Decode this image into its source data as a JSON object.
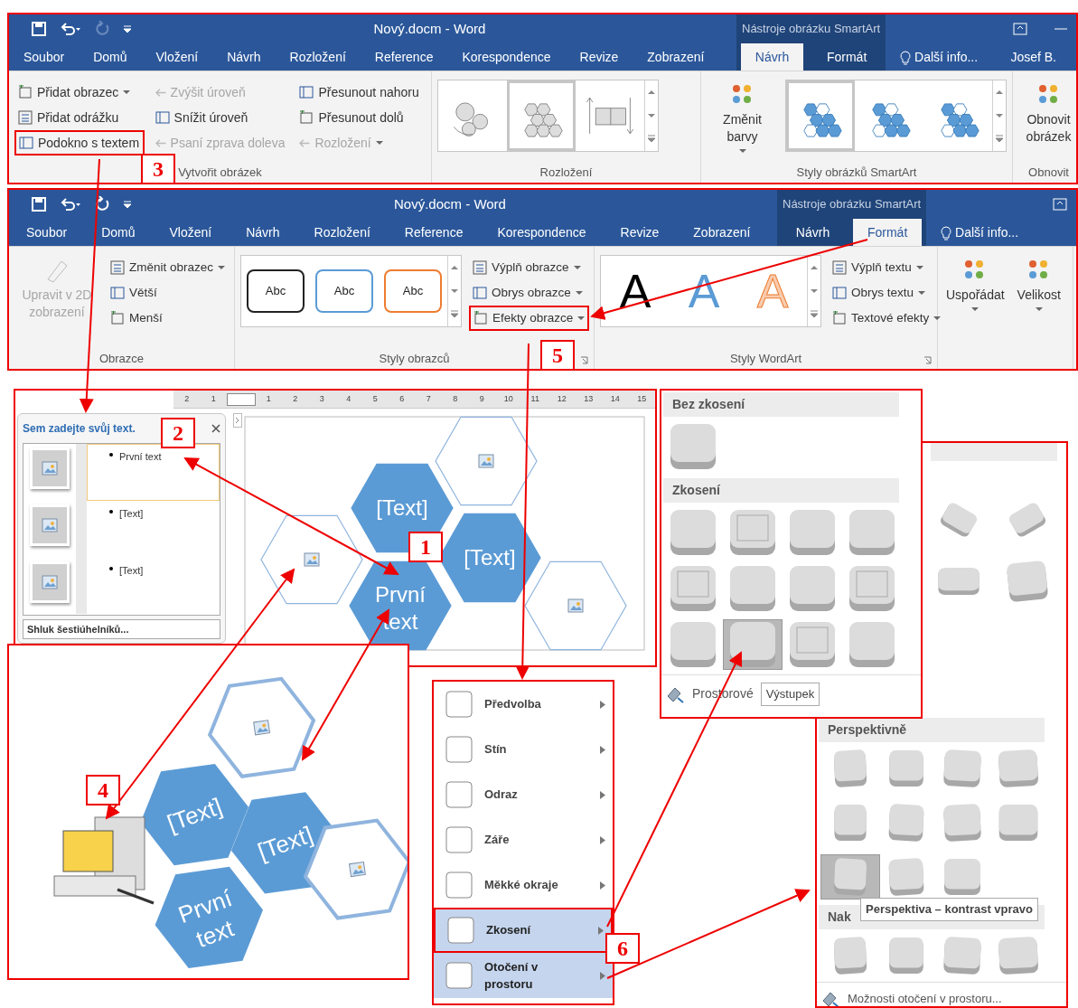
{
  "ribbons": [
    {
      "title": "Nový.docm - Word",
      "context_label": "Nástroje obrázku SmartArt",
      "redo_disabled": true,
      "minimize": true,
      "tabs": [
        {
          "label": "Soubor",
          "selected": false,
          "kind": "tab"
        },
        {
          "label": "Domů",
          "selected": false,
          "kind": "tab"
        },
        {
          "label": "Vložení",
          "selected": false,
          "kind": "tab"
        },
        {
          "label": "Návrh",
          "selected": false,
          "kind": "tab"
        },
        {
          "label": "Rozložení",
          "selected": false,
          "kind": "tab"
        },
        {
          "label": "Reference",
          "selected": false,
          "kind": "tab"
        },
        {
          "label": "Korespondence",
          "selected": false,
          "kind": "tab"
        },
        {
          "label": "Revize",
          "selected": false,
          "kind": "tab"
        },
        {
          "label": "Zobrazení",
          "selected": false,
          "kind": "tab"
        },
        {
          "label": "Návrh",
          "selected": true,
          "kind": "context"
        },
        {
          "label": "Formát",
          "selected": false,
          "kind": "context"
        },
        {
          "label": "Další info...",
          "selected": false,
          "kind": "tellme"
        },
        {
          "label": "Josef B.",
          "selected": false,
          "kind": "user"
        }
      ],
      "groups": [
        {
          "label": "Vytvořit obrázek",
          "items": [
            {
              "kind": "column",
              "commands": [
                {
                  "label": "Přidat obrazec",
                  "disabled": false,
                  "dropdown": true,
                  "highlight": false
                },
                {
                  "label": "Přidat odrážku",
                  "disabled": false,
                  "dropdown": false,
                  "highlight": false
                },
                {
                  "label": "Podokno s textem",
                  "disabled": false,
                  "dropdown": false,
                  "highlight": true
                }
              ]
            },
            {
              "kind": "column",
              "commands": [
                {
                  "label": "Zvýšit úroveň",
                  "disabled": true,
                  "dropdown": false,
                  "highlight": false
                },
                {
                  "label": "Snížit úroveň",
                  "disabled": false,
                  "dropdown": false,
                  "highlight": false
                },
                {
                  "label": "Psaní zprava doleva",
                  "disabled": true,
                  "dropdown": false,
                  "highlight": false
                }
              ]
            },
            {
              "kind": "column",
              "commands": [
                {
                  "label": "Přesunout nahoru",
                  "disabled": false,
                  "dropdown": false,
                  "highlight": false
                },
                {
                  "label": "Přesunout dolů",
                  "disabled": false,
                  "dropdown": false,
                  "highlight": false
                },
                {
                  "label": "Rozložení",
                  "disabled": true,
                  "dropdown": true,
                  "highlight": false
                }
              ]
            }
          ]
        },
        {
          "label": "Rozložení",
          "items": [
            {
              "kind": "gallery",
              "tiles": [
                {
                  "kind": "gears",
                  "selected": false
                },
                {
                  "kind": "cluster",
                  "selected": true
                },
                {
                  "kind": "boxes",
                  "selected": false
                }
              ]
            }
          ]
        },
        {
          "label": "Styly obrázků SmartArt",
          "items": [
            {
              "kind": "large",
              "label": "Změnit barvy",
              "disabled": false,
              "dropdown": true,
              "highlight": false
            },
            {
              "kind": "gallery",
              "tiles": [
                {
                  "kind": "hexstyle",
                  "selected": true
                },
                {
                  "kind": "hexstyle",
                  "selected": false
                },
                {
                  "kind": "hexstyle",
                  "selected": false
                }
              ]
            }
          ]
        },
        {
          "label": "Obnovit",
          "items": [
            {
              "kind": "large",
              "label": "Obnovit obrázek",
              "disabled": false,
              "dropdown": false,
              "highlight": false
            }
          ]
        }
      ]
    },
    {
      "title": "Nový.docm - Word",
      "context_label": "Nástroje obrázku SmartArt",
      "redo_disabled": false,
      "tabs": [
        {
          "label": "Soubor",
          "selected": false,
          "kind": "tab"
        },
        {
          "label": "Domů",
          "selected": false,
          "kind": "tab"
        },
        {
          "label": "Vložení",
          "selected": false,
          "kind": "tab"
        },
        {
          "label": "Návrh",
          "selected": false,
          "kind": "tab"
        },
        {
          "label": "Rozložení",
          "selected": false,
          "kind": "tab"
        },
        {
          "label": "Reference",
          "selected": false,
          "kind": "tab"
        },
        {
          "label": "Korespondence",
          "selected": false,
          "kind": "tab"
        },
        {
          "label": "Revize",
          "selected": false,
          "kind": "tab"
        },
        {
          "label": "Zobrazení",
          "selected": false,
          "kind": "tab"
        },
        {
          "label": "Návrh",
          "selected": false,
          "kind": "context"
        },
        {
          "label": "Formát",
          "selected": true,
          "kind": "context"
        },
        {
          "label": "Další info...",
          "selected": false,
          "kind": "tellme"
        }
      ],
      "groups": [
        {
          "label": "Obrazce",
          "items": [
            {
              "kind": "large",
              "label": "Upravit v 2D zobrazení",
              "disabled": true,
              "dropdown": false,
              "highlight": false
            },
            {
              "kind": "column",
              "commands": [
                {
                  "label": "Změnit obrazec",
                  "disabled": false,
                  "dropdown": true,
                  "highlight": false
                },
                {
                  "label": "Větší",
                  "disabled": false,
                  "dropdown": false,
                  "highlight": false
                },
                {
                  "label": "Menší",
                  "disabled": false,
                  "dropdown": false,
                  "highlight": false
                }
              ]
            }
          ]
        },
        {
          "label": "Styly obrazců",
          "launcher": true,
          "items": [
            {
              "kind": "gallery",
              "tiles": [
                {
                  "kind": "abc",
                  "text": "Abc",
                  "color": "#222222",
                  "selected": false
                },
                {
                  "kind": "abc",
                  "text": "Abc",
                  "color": "#5b9bd5",
                  "selected": false
                },
                {
                  "kind": "abc",
                  "text": "Abc",
                  "color": "#ed7d31",
                  "selected": false
                }
              ]
            },
            {
              "kind": "column",
              "commands": [
                {
                  "label": "Výplň obrazce",
                  "disabled": false,
                  "dropdown": true,
                  "highlight": false
                },
                {
                  "label": "Obrys obrazce",
                  "disabled": false,
                  "dropdown": true,
                  "highlight": false
                },
                {
                  "label": "Efekty obrazce",
                  "disabled": false,
                  "dropdown": true,
                  "highlight": true
                }
              ]
            }
          ]
        },
        {
          "label": "Styly WordArt",
          "launcher": true,
          "items": [
            {
              "kind": "gallery",
              "tiles": [
                {
                  "kind": "wordart",
                  "text": "A",
                  "color": "#000000",
                  "selected": false
                },
                {
                  "kind": "wordart",
                  "text": "A",
                  "color": "#5b9bd5",
                  "selected": false
                },
                {
                  "kind": "wordart",
                  "text": "A",
                  "color": "#f8cbad",
                  "selected": false
                }
              ]
            },
            {
              "kind": "column",
              "commands": [
                {
                  "label": "Výplň textu",
                  "disabled": false,
                  "dropdown": true,
                  "highlight": false
                },
                {
                  "label": "Obrys textu",
                  "disabled": false,
                  "dropdown": true,
                  "highlight": false
                },
                {
                  "label": "Textové efekty",
                  "disabled": false,
                  "dropdown": true,
                  "highlight": false
                }
              ]
            }
          ]
        },
        {
          "items": [
            {
              "kind": "large",
              "label": "Uspořádat",
              "disabled": false,
              "dropdown": true,
              "highlight": false
            },
            {
              "kind": "large",
              "label": "Velikost",
              "disabled": false,
              "dropdown": true,
              "highlight": false
            }
          ]
        }
      ]
    }
  ],
  "ruler": [
    "2",
    "1",
    "1",
    "2",
    "3",
    "4",
    "5",
    "6",
    "7",
    "8",
    "9",
    "10",
    "11",
    "12",
    "13",
    "14",
    "15"
  ],
  "text_pane": {
    "title": "Sem zadejte svůj text.",
    "items": [
      {
        "text": "První text",
        "selected": true
      },
      {
        "text": "[Text]",
        "selected": false
      },
      {
        "text": "[Text]",
        "selected": false
      }
    ],
    "footer": "Shluk šestiúhelníků..."
  },
  "canvas": {
    "shapes": [
      {
        "filled": false
      },
      {
        "text": "[Text]",
        "filled": true
      },
      {
        "text": "[Text]",
        "filled": true
      },
      {
        "text": "První text",
        "filled": true
      },
      {
        "filled": false
      },
      {
        "filled": false
      }
    ]
  },
  "illustration": {
    "shapes": [
      {
        "filled": false
      },
      {
        "text": "[Text]",
        "filled": true
      },
      {
        "text": "[Text]",
        "filled": true
      },
      {
        "text": "První text",
        "filled": true
      },
      {
        "filled": false
      }
    ]
  },
  "bevel_gallery": {
    "sections": [
      {
        "title": "Bez zkosení",
        "tiles": [
          {
            "selected": false
          }
        ]
      },
      {
        "title": "Zkosení",
        "tiles": [
          {
            "selected": false
          },
          {
            "selected": false
          },
          {
            "selected": false
          },
          {
            "selected": false
          },
          {
            "selected": false
          },
          {
            "selected": false
          },
          {
            "selected": false
          },
          {
            "selected": false
          },
          {
            "selected": false
          },
          {
            "selected": true
          },
          {
            "selected": false
          },
          {
            "selected": false
          }
        ]
      }
    ],
    "footer": "Prostorové",
    "tooltip": "Výstupek"
  },
  "rotation_gallery": {
    "top_tiles": [
      {
        "selected": false
      },
      {
        "selected": false
      },
      {
        "selected": false
      },
      {
        "selected": false
      }
    ],
    "sections": [
      {
        "title": "Perspektivně",
        "tiles": [
          {
            "selected": false
          },
          {
            "selected": false
          },
          {
            "selected": false
          },
          {
            "selected": false
          },
          {
            "selected": false
          },
          {
            "selected": false
          },
          {
            "selected": false
          },
          {
            "selected": false
          },
          {
            "selected": true
          },
          {
            "selected": false
          },
          {
            "selected": false
          }
        ]
      },
      {
        "title": "Nak",
        "tiles": [
          {
            "selected": false
          },
          {
            "selected": false
          },
          {
            "selected": false
          },
          {
            "selected": false
          }
        ]
      }
    ],
    "tooltip": "Perspektiva – kontrast vpravo",
    "footer": "Možnosti otočení v prostoru..."
  },
  "effects_menu": {
    "items": [
      {
        "label": "Předvolba",
        "selected": false,
        "highlight": false
      },
      {
        "label": "Stín",
        "selected": false,
        "highlight": false
      },
      {
        "label": "Odraz",
        "selected": false,
        "highlight": false
      },
      {
        "label": "Záře",
        "selected": false,
        "highlight": false
      },
      {
        "label": "Měkké okraje",
        "selected": false,
        "highlight": false
      },
      {
        "label": "Zkosení",
        "selected": true,
        "highlight": true
      },
      {
        "label": "Otočení v prostoru",
        "selected": true,
        "highlight": false
      }
    ]
  },
  "callouts": [
    "1",
    "2",
    "3",
    "4",
    "5",
    "6"
  ]
}
